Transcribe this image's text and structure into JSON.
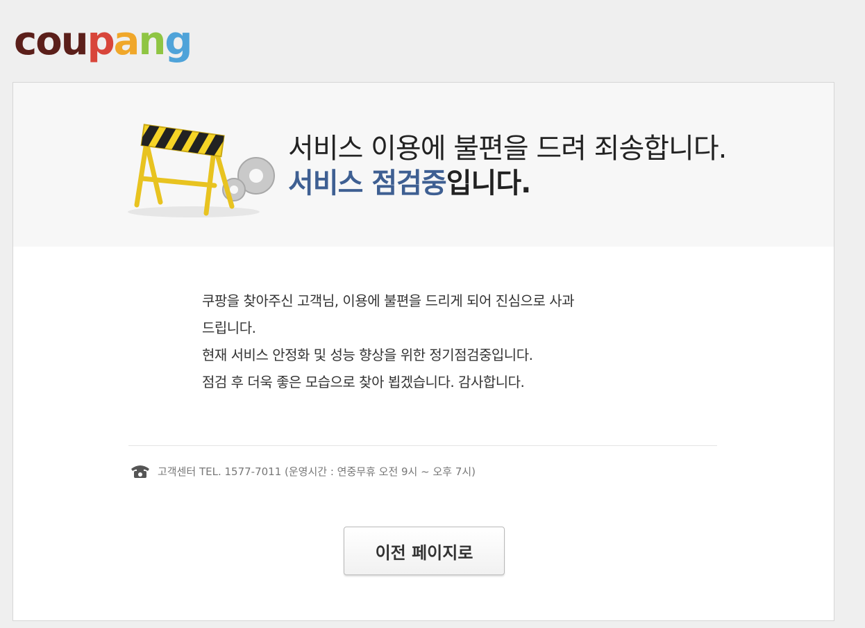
{
  "logo": {
    "letters": [
      {
        "ch": "c",
        "color": "#5b1f1a"
      },
      {
        "ch": "o",
        "color": "#5b1f1a"
      },
      {
        "ch": "u",
        "color": "#5b1f1a"
      },
      {
        "ch": "p",
        "color": "#d8453a"
      },
      {
        "ch": "a",
        "color": "#f0a72a"
      },
      {
        "ch": "n",
        "color": "#8fc543"
      },
      {
        "ch": "g",
        "color": "#4fa3d9"
      }
    ]
  },
  "hero": {
    "line1": "서비스 이용에 불편을 드려 죄송합니다.",
    "line2_accent": "서비스 점검중",
    "line2_rest": "입니다."
  },
  "message": {
    "lines": [
      "쿠팡을 찾아주신 고객님, 이용에 불편을 드리게 되어 진심으로 사과",
      "드립니다.",
      "현재 서비스 안정화 및 성능 향상을 위한 정기점검중입니다.",
      "점검 후 더욱 좋은 모습으로 찾아 뵙겠습니다. 감사합니다."
    ]
  },
  "contact": {
    "icon": "phone-icon",
    "text": "고객센터 TEL. 1577-7011 (운영시간 : 연중무휴 오전 9시 ~ 오후 7시)"
  },
  "back_button": {
    "label": "이전 페이지로"
  },
  "colors": {
    "accent": "#3e5f92",
    "background": "#efefef",
    "hero_bg": "#f7f7f7"
  }
}
